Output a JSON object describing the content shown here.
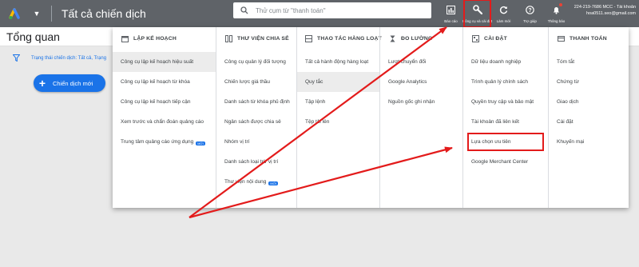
{
  "topbar": {
    "title": "Tất cả chiến dịch",
    "search_placeholder": "Thử cụm từ \"thanh toán\"",
    "actions": [
      {
        "label": "Báo cáo",
        "icon": "reports-icon"
      },
      {
        "label": "Công cụ và cài đặt",
        "icon": "tools-wrench-icon"
      },
      {
        "label": "Làm mới",
        "icon": "refresh-icon"
      },
      {
        "label": "Trợ giúp",
        "icon": "help-icon"
      },
      {
        "label": "Thông báo",
        "icon": "notification-bell-icon"
      }
    ],
    "account_line1": "224-219-7686 MCC - Tài khoản",
    "account_line2": "hoa0511.seo@gmail.com"
  },
  "page": {
    "title": "Tổng quan",
    "filter_text": "Trạng thái chiến dịch: Tất cả, Trạng",
    "new_campaign_label": "Chiến dịch mới"
  },
  "menu": {
    "columns": [
      {
        "header": "LẬP KẾ HOẠCH",
        "icon": "calendar-icon",
        "items": [
          {
            "label": "Công cụ lập kế hoạch hiệu suất"
          },
          {
            "label": "Công cụ lập kế hoạch từ khóa"
          },
          {
            "label": "Công cụ lập kế hoạch tiếp cận"
          },
          {
            "label": "Xem trước và chẩn đoán quảng cáo"
          },
          {
            "label": "Trung tâm quảng cáo ứng dụng",
            "badge": "MỚI"
          }
        ]
      },
      {
        "header": "THƯ VIỆN CHIA SẺ",
        "icon": "library-grid-icon",
        "items": [
          {
            "label": "Công cụ quản lý đối tượng"
          },
          {
            "label": "Chiến lược giá thầu"
          },
          {
            "label": "Danh sách từ khóa phủ định"
          },
          {
            "label": "Ngân sách được chia sẻ"
          },
          {
            "label": "Nhóm vị trí"
          },
          {
            "label": "Danh sách loại trừ vị trí"
          },
          {
            "label": "Thư viện nội dung",
            "badge": "MỚI"
          }
        ]
      },
      {
        "header": "THAO TÁC HÀNG LOẠT",
        "icon": "bulk-actions-icon",
        "items": [
          {
            "label": "Tất cả hành động hàng loạt"
          },
          {
            "label": "Quy tắc"
          },
          {
            "label": "Tập lệnh"
          },
          {
            "label": "Tệp tải lên"
          }
        ]
      },
      {
        "header": "ĐO LƯỜNG",
        "icon": "measurement-hourglass-icon",
        "items": [
          {
            "label": "Lượt chuyển đổi"
          },
          {
            "label": "Google Analytics"
          },
          {
            "label": "Nguồn gốc ghi nhận"
          }
        ]
      },
      {
        "header": "CÀI ĐẶT",
        "icon": "settings-grid-icon",
        "items": [
          {
            "label": "Dữ liệu doanh nghiệp"
          },
          {
            "label": "Trình quản lý chính sách"
          },
          {
            "label": "Quyền truy cập và bảo mật"
          },
          {
            "label": "Tài khoản đã liên kết"
          },
          {
            "label": "Lựa chọn ưu tiên"
          },
          {
            "label": "Google Merchant Center"
          }
        ]
      },
      {
        "header": "THANH TOÁN",
        "icon": "billing-card-icon",
        "items": [
          {
            "label": "Tóm tắt"
          },
          {
            "label": "Chứng từ"
          },
          {
            "label": "Giao dịch"
          },
          {
            "label": "Cài đặt"
          },
          {
            "label": "Khuyến mại"
          }
        ]
      }
    ]
  },
  "colors": {
    "topbar": "#5f6368",
    "primary_blue": "#1a73e8",
    "annotation_red": "#e31b1b"
  }
}
